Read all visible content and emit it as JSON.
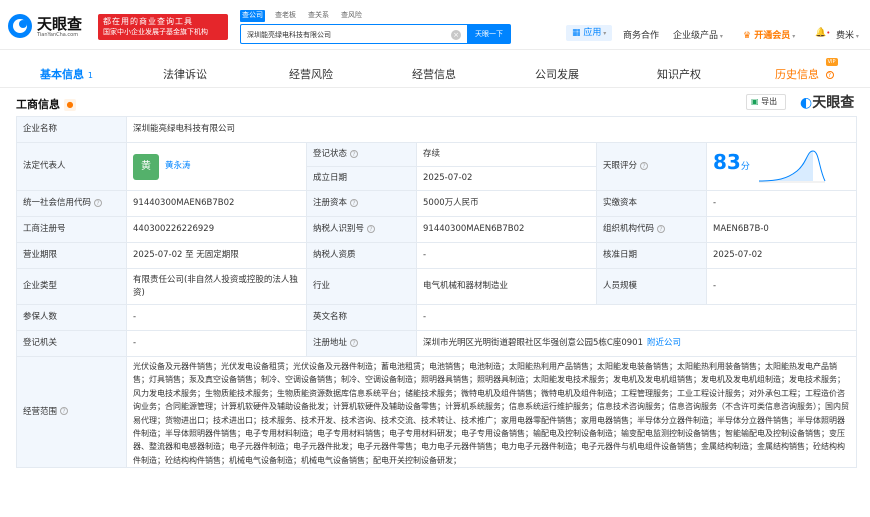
{
  "header": {
    "logo": {
      "name": "天眼查",
      "sub": "TianYanCha.com"
    },
    "slogan": {
      "line1": "都在用的商业查询工具",
      "line2": "国家中小企业发展子基金旗下机构"
    },
    "search_tabs": [
      "查公司",
      "查老板",
      "查关系",
      "查风险"
    ],
    "search_value": "深圳能亮绿电科技有限公司",
    "search_button": "天眼一下",
    "nav": {
      "app": "应用",
      "business": "商务合作",
      "enterprise": "企业级产品",
      "vip": "开通会员",
      "user": "费米"
    }
  },
  "tabs": [
    {
      "label": "基本信息",
      "badge": "1"
    },
    {
      "label": "法律诉讼"
    },
    {
      "label": "经营风险"
    },
    {
      "label": "经营信息"
    },
    {
      "label": "公司发展"
    },
    {
      "label": "知识产权"
    },
    {
      "label": "历史信息",
      "flag": "VIP"
    }
  ],
  "section": {
    "title": "工商信息",
    "export": "导出",
    "brand": "天眼查"
  },
  "info": {
    "company_name_label": "企业名称",
    "company_name": "深圳能亮绿电科技有限公司",
    "legal_rep_label": "法定代表人",
    "legal_rep_avatar": "黄",
    "legal_rep": "黄永涛",
    "reg_status_label": "登记状态",
    "reg_status": "存续",
    "established_label": "成立日期",
    "established": "2025-07-02",
    "score_label": "天眼评分",
    "score": "83",
    "score_unit": "分",
    "credit_code_label": "统一社会信用代码",
    "credit_code": "91440300MAEN6B7B02",
    "reg_capital_label": "注册资本",
    "reg_capital": "5000万人民币",
    "paid_capital_label": "实缴资本",
    "paid_capital": "-",
    "reg_no_label": "工商注册号",
    "reg_no": "440300226226929",
    "taxpayer_id_label": "纳税人识别号",
    "taxpayer_id": "91440300MAEN6B7B02",
    "org_code_label": "组织机构代码",
    "org_code": "MAEN6B7B-0",
    "term_label": "营业期限",
    "term": "2025-07-02 至 无固定期限",
    "taxpayer_qual_label": "纳税人资质",
    "taxpayer_qual": "-",
    "approved_label": "核准日期",
    "approved": "2025-07-02",
    "type_label": "企业类型",
    "type": "有限责任公司(非自然人投资或控股的法人独资)",
    "industry_label": "行业",
    "industry": "电气机械和器材制造业",
    "staff_size_label": "人员规模",
    "staff_size": "-",
    "insured_label": "参保人数",
    "insured": "-",
    "english_name_label": "英文名称",
    "english_name": "-",
    "authority_label": "登记机关",
    "authority": "-",
    "address_label": "注册地址",
    "address": "深圳市光明区光明街道碧眼社区华强创意公园5栋C座0901",
    "nearby": "附近公司",
    "scope_label": "经营范围",
    "scope": "光伏设备及元器件销售；光伏发电设备租赁；光伏设备及元器件制造；蓄电池租赁；电池销售；电池制造；太阳能热利用产品销售；太阳能发电装备销售；太阳能热利用装备销售；太阳能热发电产品销售；灯具销售；泵及真空设备销售；制冷、空调设备销售；制冷、空调设备制造；照明器具销售；照明器具制造；太阳能发电技术服务；发电机及发电机组销售；发电机及发电机组制造；发电技术服务；风力发电技术服务；生物质能技术服务；生物质能资源数据库信息系统平台；储能技术服务；微特电机及组件销售；微特电机及组件制造；工程管理服务；工业工程设计服务；对外承包工程；工程造价咨询业务；合同能源管理；计算机软硬件及辅助设备批发；计算机软硬件及辅助设备零售；计算机系统服务；信息系统运行维护服务；信息技术咨询服务；信息咨询服务（不含许可类信息咨询服务）；国内贸易代理；货物进出口；技术进出口；技术服务、技术开发、技术咨询、技术交流、技术转让、技术推广；家用电器零配件销售；家用电器销售；半导体分立器件制造；半导体分立器件销售；半导体照明器件制造；半导体照明器件销售；电子专用材料制造；电子专用材料销售；电子专用材料研发；电子专用设备销售；输配电及控制设备制造；输变配电监测控制设备销售；智能输配电及控制设备销售；变压器、整流器和电感器制造；电子元器件制造；电子元器件批发；电子元器件零售；电力电子元器件销售；电力电子元器件制造；电子元器件与机电组件设备销售；金属结构制造；金属结构销售；砼结构构件制造；砼结构构件销售；机械电气设备制造；机械电气设备销售；配电开关控制设备研发；"
  }
}
